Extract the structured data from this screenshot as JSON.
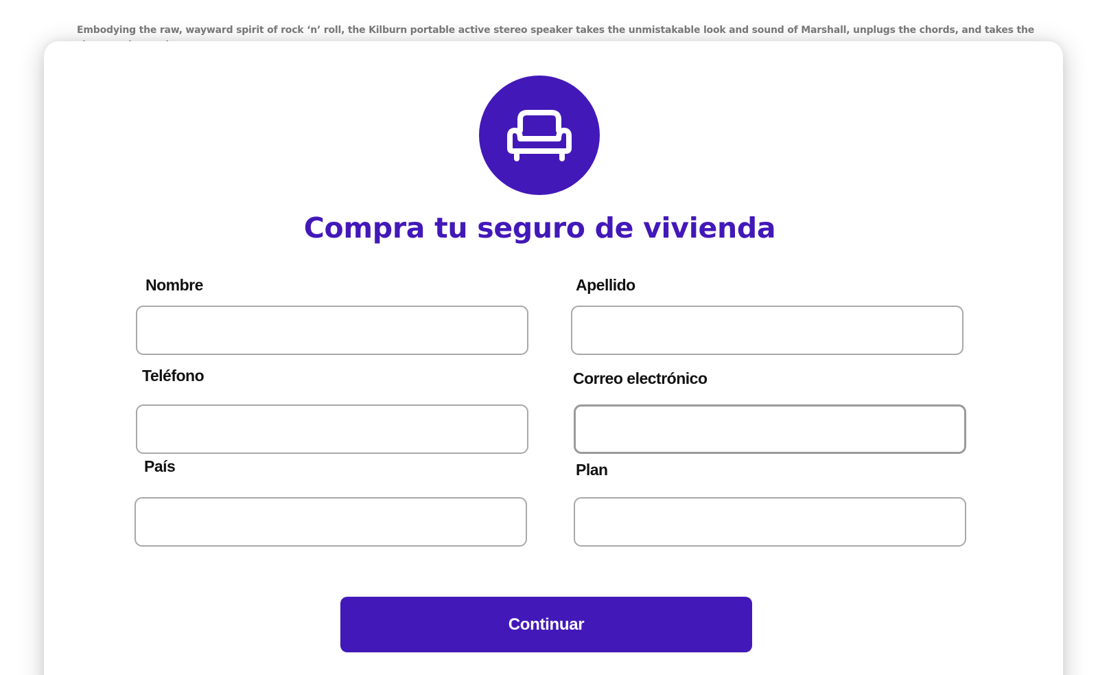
{
  "intro": {
    "text": "Embodying the raw, wayward spirit of rock ‘n’ roll, the Kilburn portable active stereo speaker takes the unmistakable look and sound of Marshall, unplugs the chords, and takes the show on the road."
  },
  "form": {
    "icon": "armchair-icon",
    "title": "Compra tu seguro de vivienda",
    "fields": {
      "nombre": {
        "label": "Nombre",
        "value": ""
      },
      "apellido": {
        "label": "Apellido",
        "value": ""
      },
      "telefono": {
        "label": "Teléfono",
        "value": ""
      },
      "correo": {
        "label": "Correo electrónico",
        "value": ""
      },
      "pais": {
        "label": "País",
        "value": ""
      },
      "plan": {
        "label": "Plan",
        "value": ""
      }
    },
    "submit_label": "Continuar"
  },
  "colors": {
    "accent": "#4318b9",
    "label_text": "#111111",
    "muted_text": "#7a7a7a",
    "input_border": "#a8a8a8"
  }
}
